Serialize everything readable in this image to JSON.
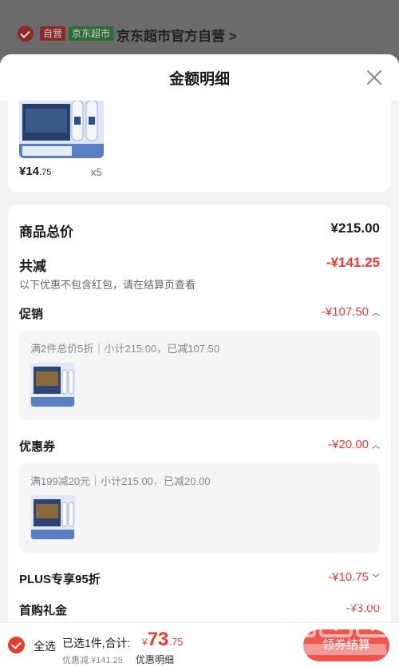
{
  "store": {
    "tag_self": "自营",
    "tag_market": "京东超市",
    "name": "京东超市官方自营",
    "chevron": ">"
  },
  "sheet": {
    "title": "金额明细"
  },
  "product": {
    "price_int": "¥14",
    "price_dec": ".75",
    "qty": "x5"
  },
  "summary": {
    "total_label": "商品总价",
    "total_value": "¥215.00",
    "reduce_label": "共减",
    "reduce_value": "-¥141.25",
    "reduce_note": "以下优惠不包含红包，请在结算页查看",
    "promo_label": "促销",
    "promo_value": "-¥107.50",
    "promo_detail": "满2件总价5折｜小计215.00，已减107.50",
    "coupon_label": "优惠券",
    "coupon_value": "-¥20.00",
    "coupon_detail": "满199减20元｜小计215.00，已减20.00",
    "plus_label": "PLUS专享95折",
    "plus_value": "-¥10.75",
    "first_label": "首购礼金",
    "first_value": "-¥3.00"
  },
  "bottom": {
    "select_all": "全选",
    "selected": "已选1件,合计:",
    "yen": "¥",
    "total_int": "73",
    "total_dec": ".75",
    "discount": "优惠减:¥141.25",
    "detail_link": "优惠明细",
    "checkout": "领券结算"
  },
  "colors": {
    "accent": "#e83a2f"
  }
}
